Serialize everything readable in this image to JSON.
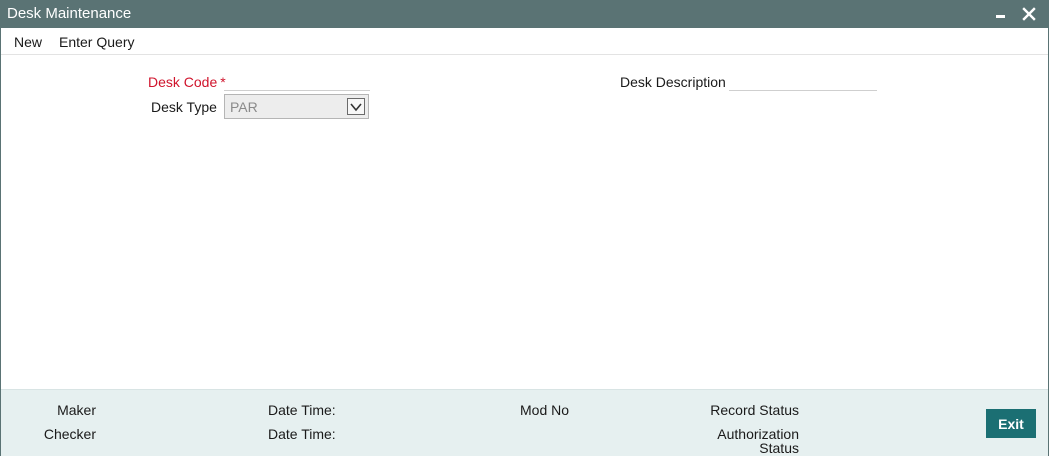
{
  "window": {
    "title": "Desk Maintenance",
    "controls": {
      "minimize_icon": "minimize-icon",
      "close_icon": "close-icon"
    },
    "colors": {
      "titlebar": "#5a7374",
      "required": "#d0142c",
      "footer_bg": "#e6f0f0",
      "exit_button": "#1b6f73"
    }
  },
  "menu": {
    "new_label": "New",
    "enter_query_label": "Enter Query"
  },
  "form": {
    "desk_code": {
      "label": "Desk Code",
      "required_marker": "*",
      "value": ""
    },
    "desk_description": {
      "label": "Desk Description",
      "value": ""
    },
    "desk_type": {
      "label": "Desk Type",
      "selected": "PAR"
    }
  },
  "footer": {
    "maker_label": "Maker",
    "checker_label": "Checker",
    "date_time_label_1": "Date Time:",
    "date_time_label_2": "Date Time:",
    "mod_no_label": "Mod No",
    "record_status_label": "Record Status",
    "authorization_label": "Authorization",
    "status_label": "Status",
    "exit_label": "Exit"
  }
}
